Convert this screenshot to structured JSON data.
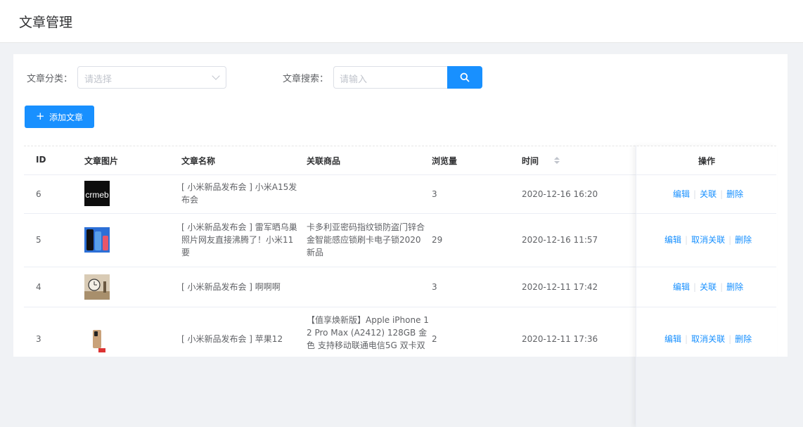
{
  "page": {
    "title": "文章管理"
  },
  "filters": {
    "category_label": "文章分类：",
    "category_placeholder": "请选择",
    "search_label": "文章搜索：",
    "search_placeholder": "请输入"
  },
  "actions": {
    "add_label": "添加文章"
  },
  "table": {
    "columns": [
      "ID",
      "文章图片",
      "文章名称",
      "关联商品",
      "浏览量",
      "时间",
      "操作"
    ],
    "rows": [
      {
        "id": "6",
        "name_lines": [
          "[ 小米新品发布会 ] 小米A15发",
          "布会"
        ],
        "product_lines": [],
        "views": "3",
        "time": "2020-12-16 16:20",
        "ops": [
          "编辑",
          "关联",
          "删除"
        ]
      },
      {
        "id": "5",
        "name_lines": [
          "[ 小米新品发布会 ] 雷军晒乌巢",
          "照片网友直接沸腾了！小米11",
          "要"
        ],
        "product_lines": [
          "卡多利亚密码指纹锁防盗门锌合",
          "金智能感应锁刷卡电子锁2020",
          "新品"
        ],
        "views": "29",
        "time": "2020-12-16 11:57",
        "ops": [
          "编辑",
          "取消关联",
          "删除"
        ]
      },
      {
        "id": "4",
        "name_lines": [
          "[ 小米新品发布会 ] 啊啊啊"
        ],
        "product_lines": [],
        "views": "3",
        "time": "2020-12-11 17:42",
        "ops": [
          "编辑",
          "关联",
          "删除"
        ]
      },
      {
        "id": "3",
        "name_lines": [
          "[ 小米新品发布会 ] 苹果12"
        ],
        "product_lines": [
          "【值享焕新版】Apple iPhone 1",
          "2 Pro Max (A2412) 128GB 金",
          "色 支持移动联通电信5G 双卡双"
        ],
        "views": "2",
        "time": "2020-12-11 17:36",
        "ops": [
          "编辑",
          "取消关联",
          "删除"
        ]
      }
    ]
  },
  "colors": {
    "primary": "#1890ff",
    "link": "#1890ff"
  }
}
